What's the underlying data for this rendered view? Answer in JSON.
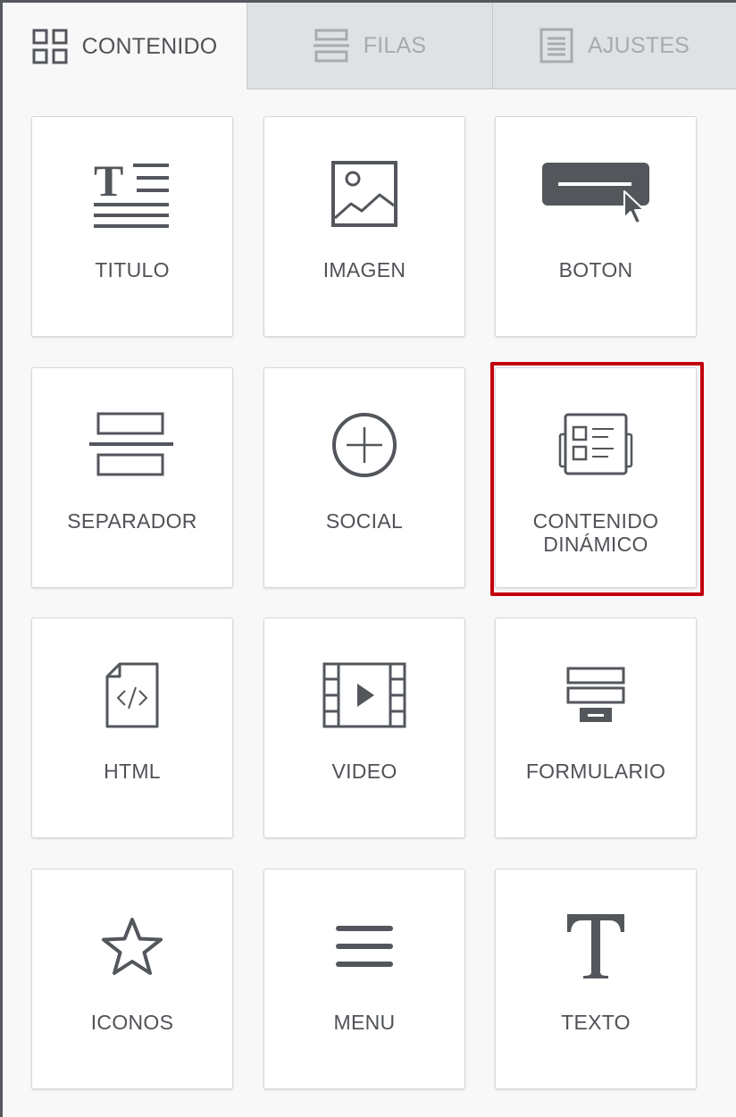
{
  "tabs": [
    {
      "label": "CONTENIDO",
      "icon": "grid-icon",
      "active": true
    },
    {
      "label": "FILAS",
      "icon": "rows-icon",
      "active": false
    },
    {
      "label": "AJUSTES",
      "icon": "settings-doc-icon",
      "active": false
    }
  ],
  "tiles": [
    {
      "label": "TITULO",
      "icon": "title-icon"
    },
    {
      "label": "IMAGEN",
      "icon": "image-icon"
    },
    {
      "label": "BOTON",
      "icon": "button-icon"
    },
    {
      "label": "SEPARADOR",
      "icon": "separator-icon"
    },
    {
      "label": "SOCIAL",
      "icon": "plus-circle-icon"
    },
    {
      "label_line1": "CONTENIDO",
      "label_line2": "DINÁMICO",
      "icon": "dynamic-content-icon",
      "highlighted": true
    },
    {
      "label": "HTML",
      "icon": "html-file-icon"
    },
    {
      "label": "VIDEO",
      "icon": "video-film-icon"
    },
    {
      "label": "FORMULARIO",
      "icon": "form-icon"
    },
    {
      "label": "ICONOS",
      "icon": "star-icon"
    },
    {
      "label": "MENU",
      "icon": "menu-icon"
    },
    {
      "label": "TEXTO",
      "icon": "text-icon"
    }
  ],
  "colors": {
    "icon": "#53575c",
    "highlight": "#c3000c",
    "tab_inactive_bg": "#dfe1e3",
    "panel_bg": "#f8f8f8"
  }
}
